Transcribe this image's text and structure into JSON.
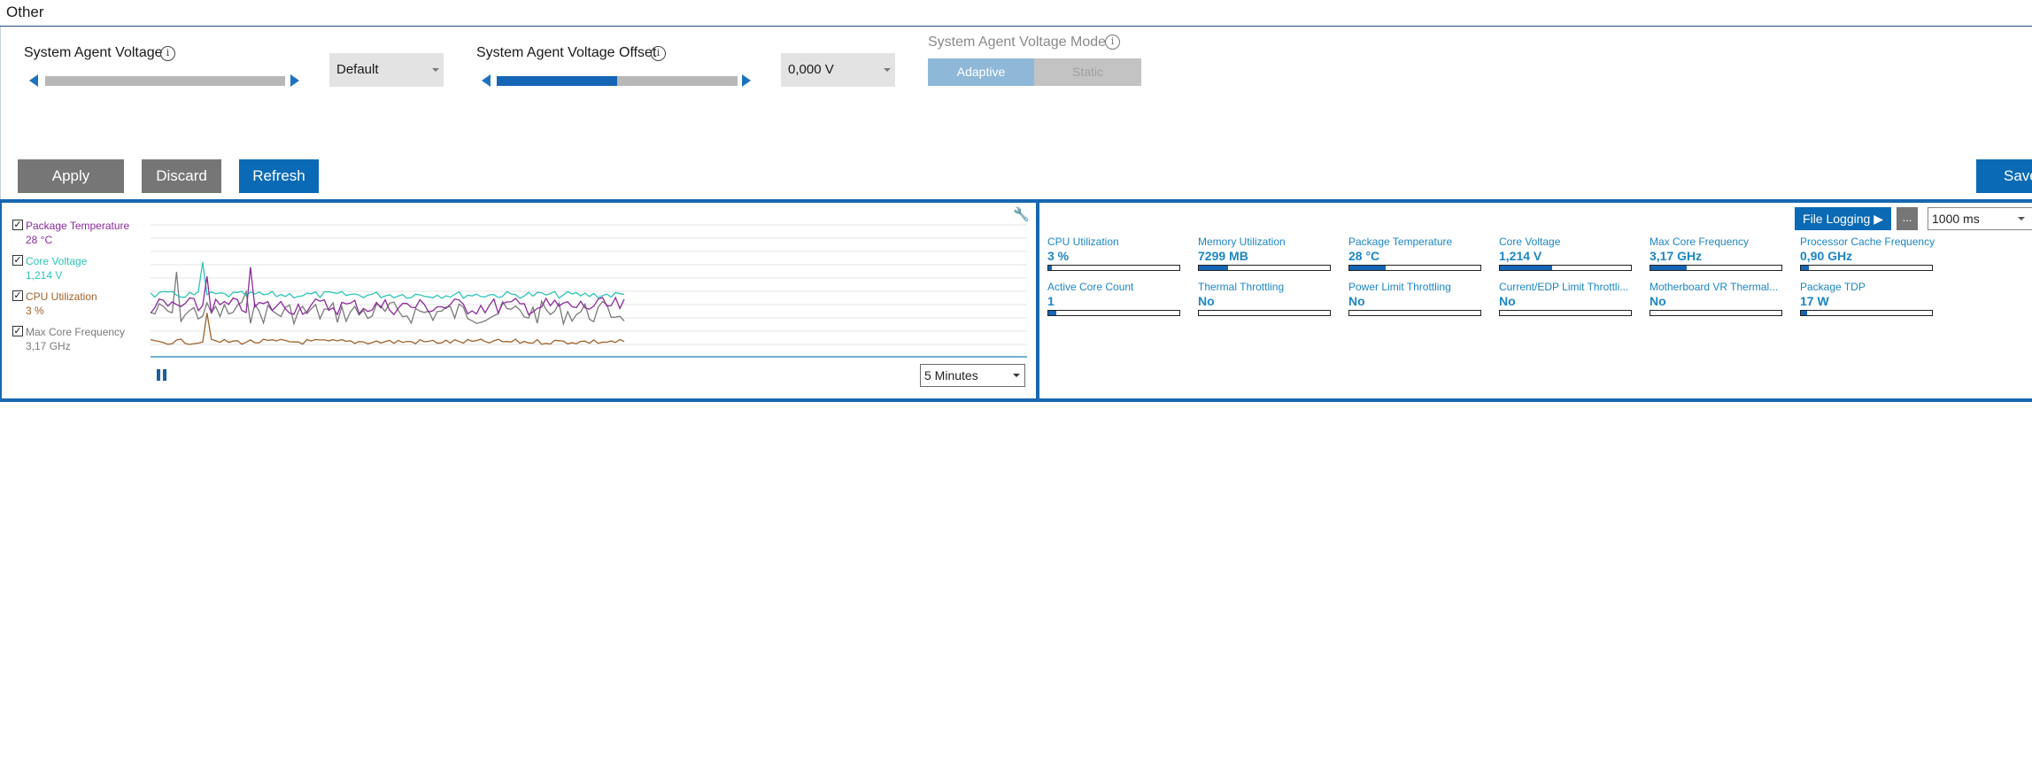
{
  "section": {
    "title": "Other"
  },
  "controls": {
    "system_agent_voltage": {
      "label": "System Agent Voltage",
      "selected": "Default",
      "level": 0
    },
    "system_agent_voltage_offset": {
      "label": "System Agent Voltage Offset",
      "selected": "0,000 V",
      "level": 0.5
    },
    "system_agent_voltage_mode": {
      "label": "System Agent Voltage Mode",
      "options": [
        "Adaptive",
        "Static"
      ]
    }
  },
  "icons": {
    "info": "info-icon",
    "wrench": "wrench-icon",
    "pause": "pause-icon"
  },
  "actions": {
    "apply": "Apply",
    "discard": "Discard",
    "refresh": "Refresh",
    "save": "Save"
  },
  "monitor": {
    "legend": [
      {
        "name": "Package Temperature",
        "value": "28 °C",
        "color": "#8b2a9c"
      },
      {
        "name": "Core Voltage",
        "value": "1,214 V",
        "color": "#2ec4b6"
      },
      {
        "name": "CPU Utilization",
        "value": "3 %",
        "color": "#a0622a"
      },
      {
        "name": "Max Core Frequency",
        "value": "3,17 GHz",
        "color": "#7a7a7a"
      }
    ],
    "time_range": "5 Minutes",
    "file_logging": "File Logging ▶",
    "more": "...",
    "interval": "1000 ms",
    "metrics": [
      {
        "label": "CPU Utilization",
        "value": "3 %",
        "level": 0.03
      },
      {
        "label": "Memory Utilization",
        "value": "7299  MB",
        "level": 0.22
      },
      {
        "label": "Package Temperature",
        "value": "28 °C",
        "level": 0.28
      },
      {
        "label": "Core Voltage",
        "value": "1,214 V",
        "level": 0.4
      },
      {
        "label": "Max Core Frequency",
        "value": "3,17 GHz",
        "level": 0.28
      },
      {
        "label": "Processor Cache Frequency",
        "value": "0,90 GHz",
        "level": 0.06
      },
      {
        "label": "Active Core Count",
        "value": "1",
        "level": 0.06
      },
      {
        "label": "Thermal Throttling",
        "value": "No",
        "level": 0
      },
      {
        "label": "Power Limit Throttling",
        "value": "No",
        "level": 0
      },
      {
        "label": "Current/EDP Limit Throttli...",
        "value": "No",
        "level": 0
      },
      {
        "label": "Motherboard VR Thermal...",
        "value": "No",
        "level": 0
      },
      {
        "label": "Package TDP",
        "value": "17 W",
        "level": 0.05
      }
    ]
  }
}
